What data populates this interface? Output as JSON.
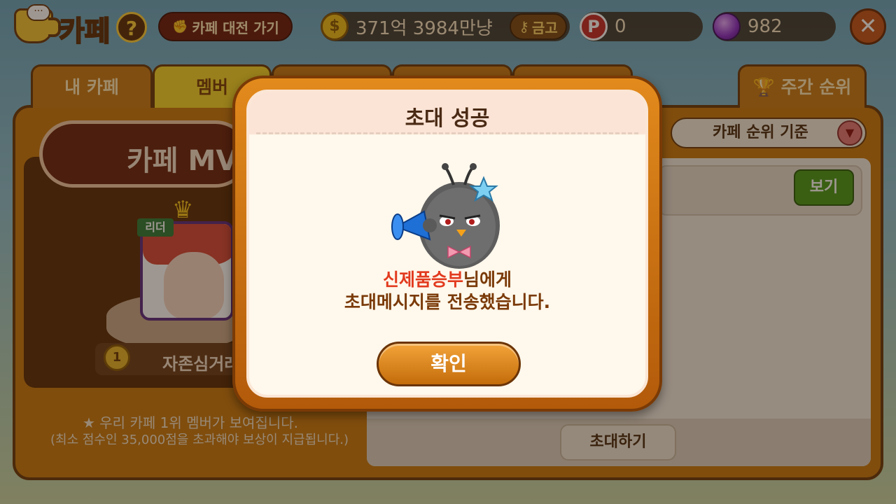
{
  "topbar": {
    "logo_bubble": "···",
    "title": "카페",
    "help": "?",
    "battle_button": "카페 대전 가기",
    "gold": "371억 3984만냥",
    "vault_button": "금고",
    "points": "0",
    "gems": "982",
    "close": "✕"
  },
  "tabs": {
    "my_cafe": "내 카페",
    "member": "멤버",
    "weekly_rank": "주간 순위"
  },
  "left": {
    "mvp_title": "카페 MV",
    "leader_badge": "리더",
    "rank_number": "1",
    "rank_name": "자존심거래",
    "note_line1": "★ 우리 카페 1위 멤버가 보여집니다.",
    "note_line2": "(최소 점수인 35,000점을 초과해야 보상이 지급됩니다.)"
  },
  "right": {
    "sort_label": "카페 순위 기준",
    "view_button": "보기",
    "invite_button": "초대하기"
  },
  "modal": {
    "title": "초대 성공",
    "recipient": "신제품승부",
    "message_suffix": "님에게",
    "message_line2": "초대메시지를 전송했습니다.",
    "confirm": "확인"
  },
  "colors": {
    "accent_orange": "#c8790f",
    "recipient_red": "#e23a1e",
    "view_green": "#4a9a1a"
  }
}
